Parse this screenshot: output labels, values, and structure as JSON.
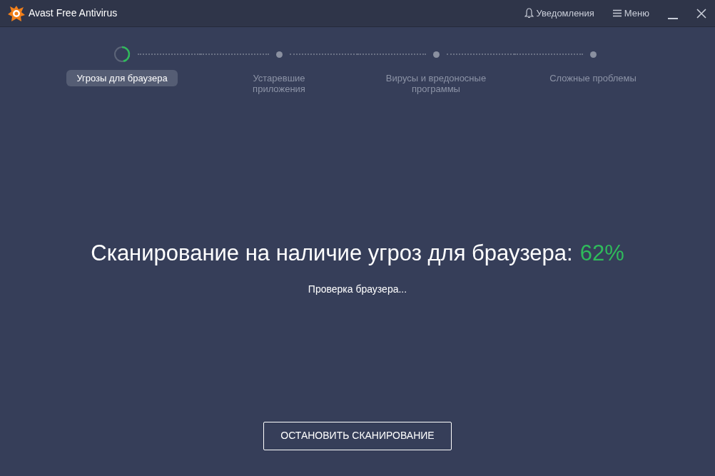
{
  "window": {
    "title": "Avast Free Antivirus",
    "notifications": "Уведомления",
    "menu": "Меню"
  },
  "steps": [
    {
      "label": "Угрозы для браузера",
      "selected": true
    },
    {
      "label": "Устаревшие приложения",
      "selected": false
    },
    {
      "label": "Вирусы и вредоносные программы",
      "selected": false
    },
    {
      "label": "Сложные проблемы",
      "selected": false
    }
  ],
  "scan": {
    "title": "Сканирование на наличие угроз для браузера:",
    "percent": "62%",
    "status": "Проверка браузера..."
  },
  "stop_button": "ОСТАНОВИТЬ СКАНИРОВАНИЕ"
}
